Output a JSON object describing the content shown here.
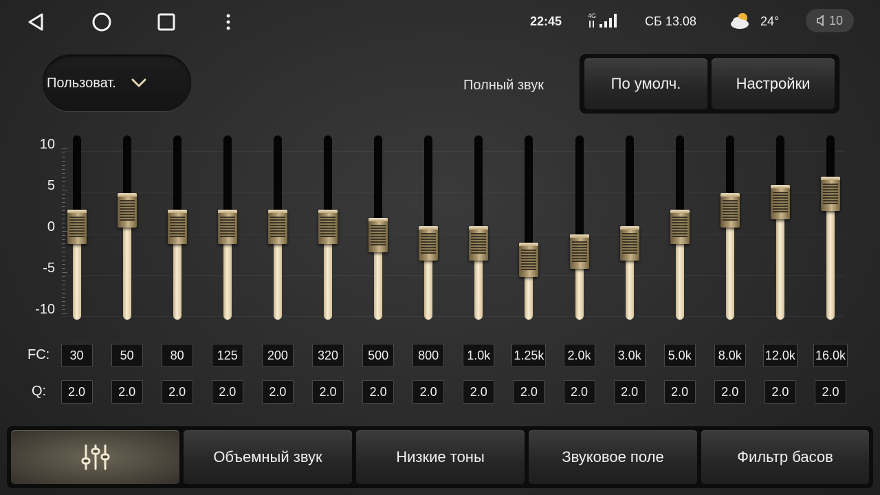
{
  "status": {
    "time": "22:45",
    "network_label": "4G",
    "date": "СБ 13.08",
    "temperature": "24°",
    "volume": "10",
    "nav_icons": [
      "back-icon",
      "home-icon",
      "recents-icon",
      "more-icon"
    ]
  },
  "preset": {
    "label": "Пользоват."
  },
  "header": {
    "full_sound_label": "Полный звук",
    "default_button": "По умолч.",
    "settings_button": "Настройки"
  },
  "eq": {
    "y_ticks": [
      "10",
      "5",
      "0",
      "-5",
      "-10"
    ],
    "bands": [
      {
        "fc": "30",
        "q": "2.0",
        "gain": 0
      },
      {
        "fc": "50",
        "q": "2.0",
        "gain": 2
      },
      {
        "fc": "80",
        "q": "2.0",
        "gain": 0
      },
      {
        "fc": "125",
        "q": "2.0",
        "gain": 0
      },
      {
        "fc": "200",
        "q": "2.0",
        "gain": 0
      },
      {
        "fc": "320",
        "q": "2.0",
        "gain": 0
      },
      {
        "fc": "500",
        "q": "2.0",
        "gain": -1
      },
      {
        "fc": "800",
        "q": "2.0",
        "gain": -2
      },
      {
        "fc": "1.0k",
        "q": "2.0",
        "gain": -2
      },
      {
        "fc": "1.25k",
        "q": "2.0",
        "gain": -4
      },
      {
        "fc": "2.0k",
        "q": "2.0",
        "gain": -3
      },
      {
        "fc": "3.0k",
        "q": "2.0",
        "gain": -2
      },
      {
        "fc": "5.0k",
        "q": "2.0",
        "gain": 0
      },
      {
        "fc": "8.0k",
        "q": "2.0",
        "gain": 2
      },
      {
        "fc": "12.0k",
        "q": "2.0",
        "gain": 3
      },
      {
        "fc": "16.0k",
        "q": "2.0",
        "gain": 4
      }
    ],
    "gain_range": [
      -10,
      10
    ],
    "fc_label": "FC:",
    "q_label": "Q:"
  },
  "tabs": [
    {
      "label": "",
      "icon": "equalizer-icon",
      "active": true
    },
    {
      "label": "Объемный звук",
      "active": false
    },
    {
      "label": "Низкие тоны",
      "active": false
    },
    {
      "label": "Звуковое поле",
      "active": false
    },
    {
      "label": "Фильтр басов",
      "active": false
    }
  ],
  "colors": {
    "accent_gold": "#d9c7a0",
    "track_dark": "#050505"
  }
}
